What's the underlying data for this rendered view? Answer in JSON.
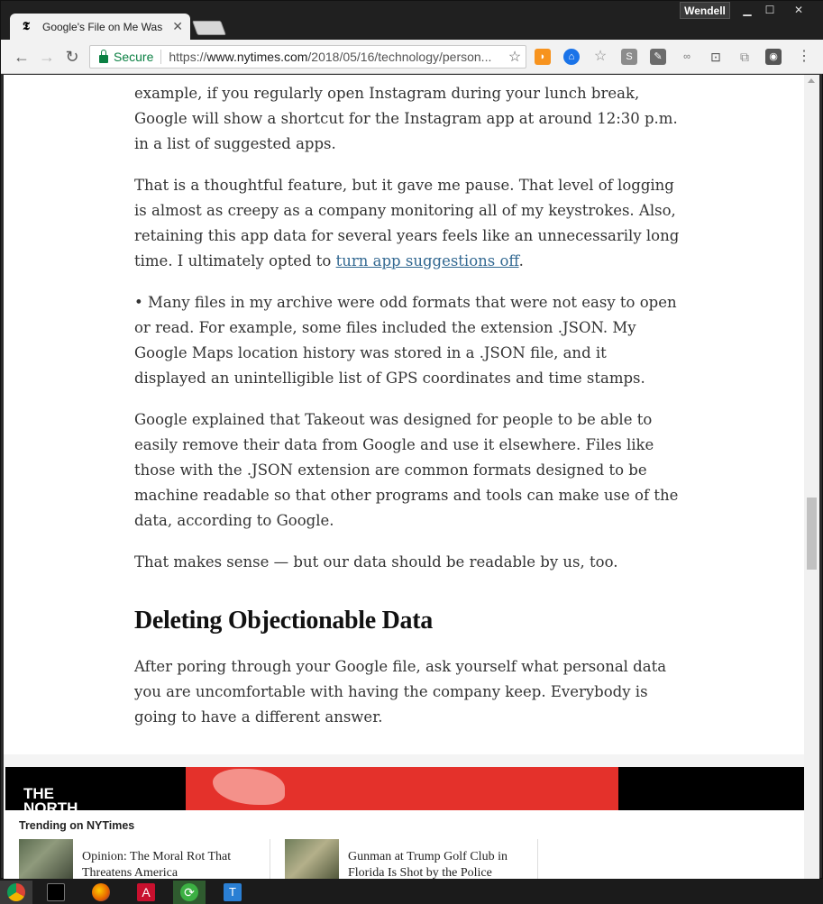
{
  "browser": {
    "tab_title": "Google's File on Me Was",
    "profile_name": "Wendell",
    "secure_label": "Secure",
    "url_prefix": "https://",
    "url_host": "www.nytimes.com",
    "url_path": "/2018/05/16/technology/person..."
  },
  "article": {
    "paragraphs": [
      "example, if you regularly open Instagram during your lunch break, Google will show a shortcut for the Instagram app at around 12:30 p.m. in a list of suggested apps.",
      "That is a thoughtful feature, but it gave me pause. That level of logging is almost as creepy as a company monitoring all of my keystrokes. Also, retaining this app data for several years feels like an unnecessarily long time. I ultimately opted to",
      "• Many files in my archive were odd formats that were not easy to open or read. For example, some files included the extension .JSON. My Google Maps location history was stored in a .JSON file, and it displayed an unintelligible list of GPS coordinates and time stamps.",
      "Google explained that Takeout was designed for people to be able to easily remove their data from Google and use it elsewhere. Files like those with the .JSON extension are common formats designed to be machine readable so that other programs and tools can make use of the data, according to Google.",
      "That makes sense — but our data should be readable by us, too."
    ],
    "link_text": "turn app suggestions off",
    "link_suffix": ".",
    "heading": "Deleting Objectionable Data",
    "paragraph_after_heading": "After poring through your Google file, ask yourself what personal data you are uncomfortable with having the company keep. Everybody is going to have a different answer."
  },
  "ad": {
    "logo_line1": "THE",
    "logo_line2": "NORTH"
  },
  "trending": {
    "title": "Trending on NYTimes",
    "items": [
      {
        "headline": "Opinion: The Moral Rot That Threatens America"
      },
      {
        "headline": "Gunman at Trump Golf Club in Florida Is Shot by the Police"
      }
    ]
  },
  "icons": {
    "back": "←",
    "forward": "→",
    "reload": "↻",
    "star": "☆",
    "menu": "⋮",
    "close": "✕"
  }
}
